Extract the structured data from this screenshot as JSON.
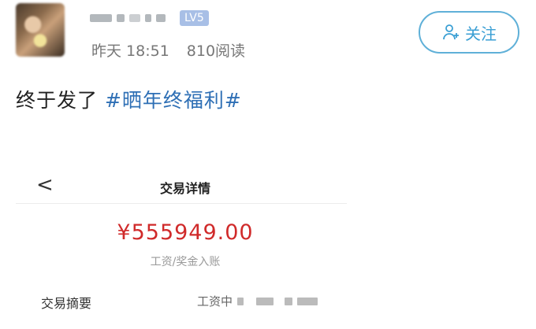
{
  "post_header": {
    "level_badge": "LV5",
    "time": "昨天 18:51",
    "reads": "810阅读",
    "follow_label": "关注"
  },
  "post": {
    "text": "终于发了",
    "hashtag": "#晒年终福利#"
  },
  "transaction": {
    "title": "交易详情",
    "back_glyph": "<",
    "amount": "¥555949.00",
    "amount_desc": "工资/奖金入账",
    "summary_label": "交易摘要",
    "summary_value": "工资中"
  }
}
